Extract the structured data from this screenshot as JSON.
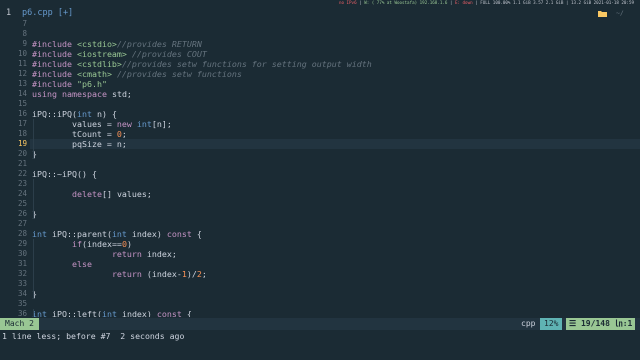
{
  "topbar": {
    "sys_a": "no IPv6",
    "sys_b": "W: ( 77% at Woostafa) 192.168.1.6",
    "sys_c": "E: down",
    "sys_d": "FULL 100.00% 1.1 GiB 3.57 2.1 GiB | 13.2 GiB 2021-01-18 20:59"
  },
  "tabline": {
    "tab_number": "1",
    "tab_label": "p6.cpp [+]",
    "cwd": "~/",
    "folder_icon": "folder-icon"
  },
  "editor": {
    "lines": [
      {
        "n": "7",
        "text": ""
      },
      {
        "n": "8",
        "text": ""
      },
      {
        "n": "9",
        "text": "#include <cstdio>//provides RETURN"
      },
      {
        "n": "10",
        "text": "#include <iostream> //provides COUT"
      },
      {
        "n": "11",
        "text": "#include <cstdlib>//provides setw functions for setting output width"
      },
      {
        "n": "12",
        "text": "#include <cmath> //provides setw functions"
      },
      {
        "n": "13",
        "text": "#include \"p6.h\""
      },
      {
        "n": "14",
        "text": "using namespace std;"
      },
      {
        "n": "15",
        "text": ""
      },
      {
        "n": "16",
        "text": "iPQ::iPQ(int n) {"
      },
      {
        "n": "17",
        "text": "        values = new int[n];"
      },
      {
        "n": "18",
        "text": "        tCount = 0;"
      },
      {
        "n": "19",
        "text": "        pqSize = n;"
      },
      {
        "n": "20",
        "text": "}"
      },
      {
        "n": "21",
        "text": ""
      },
      {
        "n": "22",
        "text": "iPQ::~iPQ() {"
      },
      {
        "n": "23",
        "text": ""
      },
      {
        "n": "24",
        "text": "        delete[] values;"
      },
      {
        "n": "25",
        "text": ""
      },
      {
        "n": "26",
        "text": "}"
      },
      {
        "n": "27",
        "text": ""
      },
      {
        "n": "28",
        "text": "int iPQ::parent(int index) const {"
      },
      {
        "n": "29",
        "text": "        if(index==0)"
      },
      {
        "n": "30",
        "text": "                return index;"
      },
      {
        "n": "31",
        "text": "        else"
      },
      {
        "n": "32",
        "text": "                return (index-1)/2;"
      },
      {
        "n": "33",
        "text": ""
      },
      {
        "n": "34",
        "text": "}"
      },
      {
        "n": "35",
        "text": ""
      },
      {
        "n": "36",
        "text": "int iPQ::left(int index) const {"
      }
    ],
    "current_line": "19"
  },
  "statusline": {
    "mode": "Mach 2",
    "filetype": "cpp",
    "percent": "12%",
    "position": "☰ 19/148 ㏑:1"
  },
  "message": "1 line less; before #7  2 seconds ago",
  "colors": {
    "background": "#1b2b34",
    "keyword": "#c594c5",
    "type": "#6699cc",
    "comment": "#65737e",
    "string": "#99c794",
    "number": "#f99157",
    "mode_bg": "#99c794",
    "percent_bg": "#5fb3b3"
  }
}
